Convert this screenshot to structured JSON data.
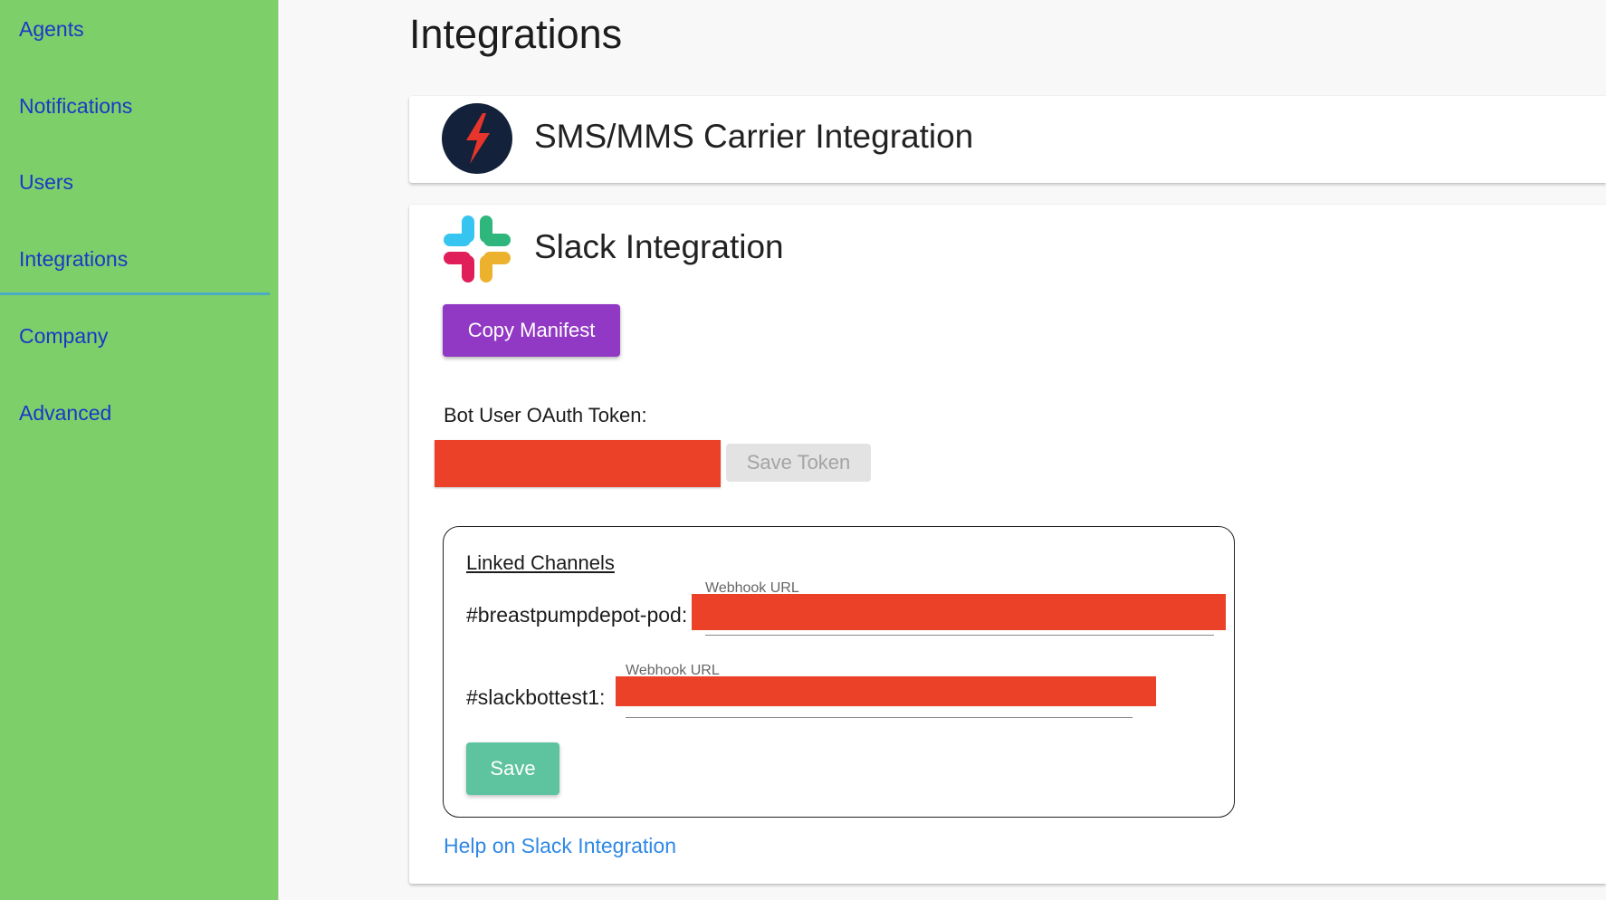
{
  "sidebar": {
    "items": [
      {
        "label": "Agents"
      },
      {
        "label": "Notifications"
      },
      {
        "label": "Users"
      },
      {
        "label": "Integrations",
        "active": true
      },
      {
        "label": "Company"
      },
      {
        "label": "Advanced"
      }
    ]
  },
  "page": {
    "title": "Integrations"
  },
  "sms_card": {
    "title": "SMS/MMS Carrier Integration"
  },
  "slack_card": {
    "title": "Slack Integration",
    "copy_manifest_label": "Copy Manifest",
    "token_label": "Bot User OAuth Token:",
    "token_value": "",
    "save_token_label": "Save Token",
    "linked_channels": {
      "title": "Linked Channels",
      "channels": [
        {
          "name": "#breastpumpdepot-pod:",
          "webhook_label": "Webhook URL",
          "webhook_value": ""
        },
        {
          "name": "#slackbottest1:",
          "webhook_label": "Webhook URL",
          "webhook_value": ""
        }
      ],
      "save_label": "Save"
    },
    "help_link": "Help on Slack Integration"
  },
  "colors": {
    "sidebar_bg": "#7dcf6a",
    "nav_link": "#1a38c7",
    "manifest_button": "#9139c4",
    "save_button": "#5ec39f",
    "redaction": "#ea4128",
    "help_link": "#2f88e6"
  },
  "icons": {
    "sms_logo": "lightning-bolt-icon",
    "slack_logo": "slack-logo-icon"
  }
}
